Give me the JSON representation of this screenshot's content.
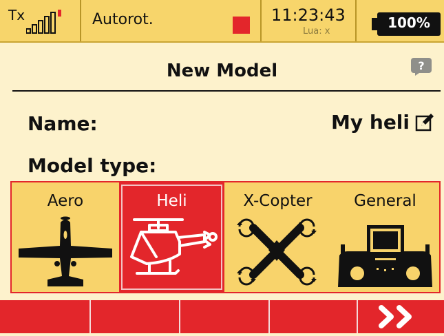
{
  "statusbar": {
    "tx_label": "Tx",
    "signal_bars_active": 5,
    "mode": "Autorot.",
    "time": "11:23:43",
    "lua": "Lua: x",
    "battery": "100%"
  },
  "page": {
    "title": "New Model"
  },
  "help_icon": "help-icon",
  "fields": {
    "name_label": "Name:",
    "name_value": "My heli",
    "model_type_label": "Model type:"
  },
  "model_types": [
    {
      "label": "Aero",
      "icon": "airplane-icon",
      "selected": false
    },
    {
      "label": "Heli",
      "icon": "helicopter-icon",
      "selected": true
    },
    {
      "label": "X-Copter",
      "icon": "quadcopter-icon",
      "selected": false
    },
    {
      "label": "General",
      "icon": "transmitter-icon",
      "selected": false
    }
  ],
  "softkeys": [
    "",
    "",
    "",
    "",
    "»"
  ],
  "colors": {
    "accent": "#e3262b",
    "background": "#fdf2cc",
    "statusbar": "#f7d56b",
    "selector": "#f8d36b"
  }
}
